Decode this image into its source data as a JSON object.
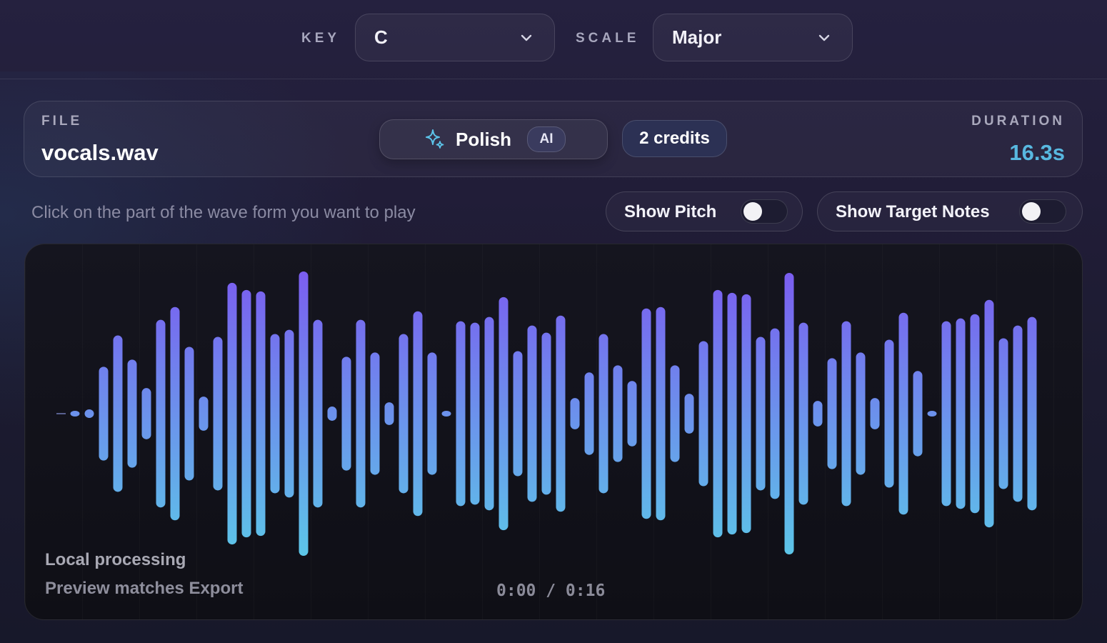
{
  "toolbar": {
    "key_label": "KEY",
    "key_value": "C",
    "scale_label": "SCALE",
    "scale_value": "Major"
  },
  "file": {
    "caption": "FILE",
    "name": "vocals.wav",
    "duration_caption": "DURATION",
    "duration": "16.3s"
  },
  "actions": {
    "polish_label": "Polish",
    "ai_badge": "AI",
    "credits": "2 credits"
  },
  "controls": {
    "hint": "Click on the part of the wave form you want to play",
    "show_pitch": "Show Pitch",
    "show_pitch_on": false,
    "show_target_notes": "Show Target Notes",
    "show_target_notes_on": false
  },
  "waveform": {
    "amplitudes": [
      0.01,
      0.03,
      0.33,
      0.55,
      0.38,
      0.18,
      0.66,
      0.75,
      0.47,
      0.12,
      0.54,
      0.92,
      0.87,
      0.86,
      0.56,
      0.59,
      1.0,
      0.66,
      0.05,
      0.4,
      0.66,
      0.43,
      0.08,
      0.56,
      0.72,
      0.43,
      0.01,
      0.65,
      0.64,
      0.68,
      0.82,
      0.44,
      0.62,
      0.57,
      0.69,
      0.11,
      0.29,
      0.56,
      0.34,
      0.23,
      0.74,
      0.75,
      0.34,
      0.14,
      0.51,
      0.87,
      0.85,
      0.84,
      0.54,
      0.6,
      0.99,
      0.64,
      0.09,
      0.39,
      0.65,
      0.43,
      0.11,
      0.52,
      0.71,
      0.3,
      0.01,
      0.65,
      0.67,
      0.7,
      0.8,
      0.53,
      0.62,
      0.68
    ],
    "color_top": "#7b5cf0",
    "color_bottom": "#5cc7e8",
    "footer_line1": "Local processing",
    "footer_line2": "Preview matches Export",
    "time": "0:00 / 0:16"
  }
}
